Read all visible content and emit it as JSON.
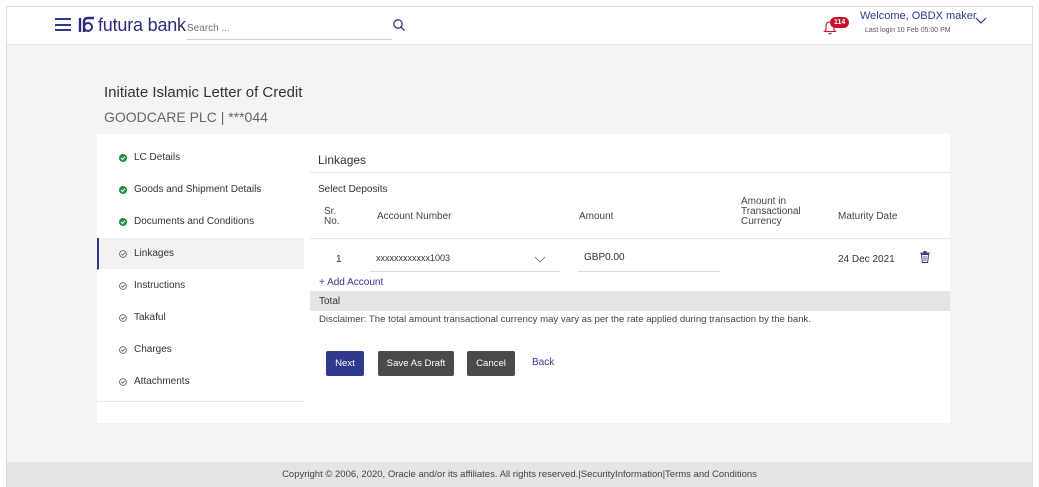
{
  "header": {
    "logo_text": "futura bank",
    "search_placeholder": "Search ...",
    "notification_count": "114",
    "welcome": "Welcome, OBDX maker",
    "last_login": "Last login 10 Feb 05:00 PM"
  },
  "page": {
    "title": "Initiate Islamic Letter of Credit",
    "subtitle": "GOODCARE PLC | ***044"
  },
  "sidebar": {
    "items": [
      {
        "label": "LC Details",
        "status": "complete"
      },
      {
        "label": "Goods and Shipment Details",
        "status": "complete"
      },
      {
        "label": "Documents and Conditions",
        "status": "complete"
      },
      {
        "label": "Linkages",
        "status": "active"
      },
      {
        "label": "Instructions",
        "status": "pending"
      },
      {
        "label": "Takaful",
        "status": "pending"
      },
      {
        "label": "Charges",
        "status": "pending"
      },
      {
        "label": "Attachments",
        "status": "pending"
      }
    ]
  },
  "linkages": {
    "title": "Linkages",
    "select_deposits": "Select Deposits",
    "columns": {
      "sr_no_1": "Sr.",
      "sr_no_2": "No.",
      "account_number": "Account Number",
      "amount": "Amount",
      "amount_txn_1": "Amount in",
      "amount_txn_2": "Transactional",
      "amount_txn_3": "Currency",
      "maturity_date": "Maturity Date"
    },
    "rows": [
      {
        "sr": "1",
        "account": "xxxxxxxxxxxx1003",
        "amount": "GBP0.00",
        "amount_txn": "",
        "maturity": "24 Dec 2021"
      }
    ],
    "add_account": "+ Add Account",
    "total_label": "Total",
    "disclaimer": "Disclaimer: The total amount transactional currency may vary as per the rate applied during transaction by the bank."
  },
  "actions": {
    "next": "Next",
    "save_draft": "Save As Draft",
    "cancel": "Cancel",
    "back": "Back"
  },
  "footer": {
    "copyright": "Copyright © 2006, 2020, Oracle and/or its affiliates. All rights reserved.",
    "security": "SecurityInformation",
    "terms": "Terms and Conditions"
  },
  "colors": {
    "brand": "#2f3a8f",
    "complete_green": "#2e8b3a",
    "badge_red": "#c8102e"
  }
}
